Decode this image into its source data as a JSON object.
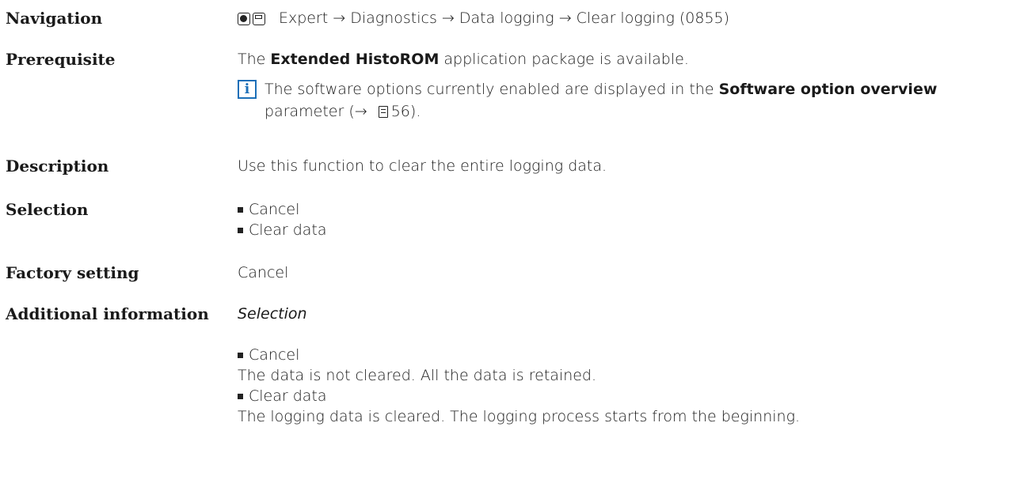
{
  "navigation": {
    "label": "Navigation",
    "path": "Expert → Diagnostics → Data logging → Clear logging (0855)",
    "icons": [
      "operation-icon",
      "display-icon"
    ]
  },
  "prerequisite": {
    "label": "Prerequisite",
    "text_prefix": "The ",
    "text_bold": "Extended HistoROM",
    "text_suffix": " application package is available.",
    "note": {
      "icon": "info-icon",
      "icon_glyph": "i",
      "prefix": "The software options currently enabled are displayed in the ",
      "bold": "Software option overview",
      "suffix_before_ref": " parameter (→ ",
      "page_ref": "56",
      "suffix_after_ref": ")."
    }
  },
  "description": {
    "label": "Description",
    "text": "Use this function to clear the entire logging data."
  },
  "selection": {
    "label": "Selection",
    "options": [
      "Cancel",
      "Clear data"
    ]
  },
  "factory_setting": {
    "label": "Factory setting",
    "value": "Cancel"
  },
  "additional_information": {
    "label": "Additional information",
    "heading": "Selection",
    "items": [
      {
        "term": "Cancel",
        "detail": "The data is not cleared. All the data is retained."
      },
      {
        "term": "Clear data",
        "detail": "The logging data is cleared. The logging process starts from the beginning."
      }
    ]
  },
  "colors": {
    "info_accent": "#1c6fb8",
    "text": "#1a1a1a"
  }
}
